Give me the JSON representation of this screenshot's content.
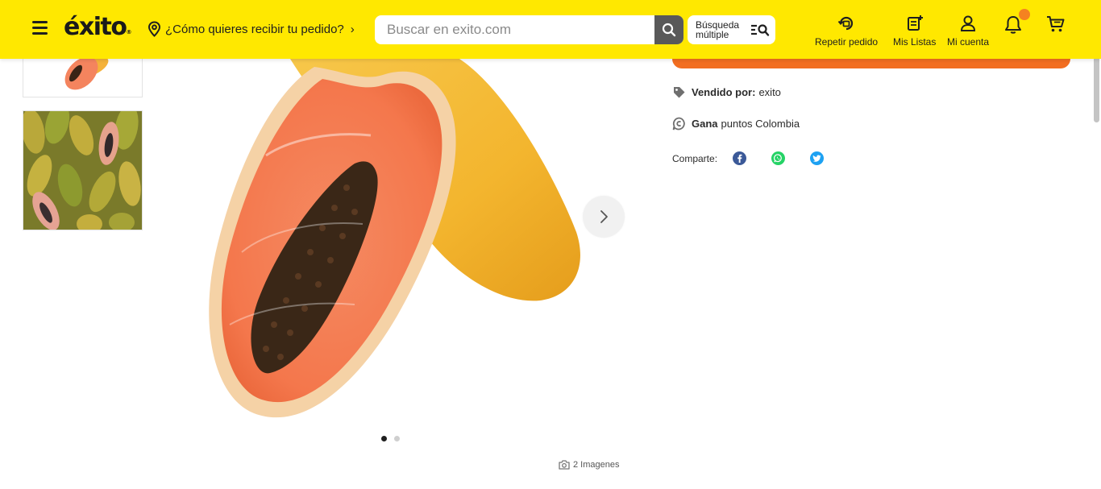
{
  "header": {
    "logo_text": "éxito",
    "logo_mark": "®",
    "delivery_prompt": "¿Cómo quieres recibir tu pedido?",
    "search_placeholder": "Buscar en exito.com",
    "multi_search_label": "Búsqueda múltiple",
    "nav": [
      {
        "label": "Repetir pedido",
        "icon": "repeat-order-icon"
      },
      {
        "label": "Mis Listas",
        "icon": "lists-icon"
      },
      {
        "label": "Mi cuenta",
        "icon": "user-icon"
      }
    ],
    "notification_badge_color": "#f58220",
    "brand_color": "#ffe800"
  },
  "gallery": {
    "image_count_text": "2 Imagenes",
    "total_images": 2,
    "active_index": 0,
    "main_image_subject": "papaya"
  },
  "product_info": {
    "sold_by_label": "Vendido por:",
    "sold_by_value": "exito",
    "earn_label": "Gana",
    "earn_value": "puntos Colombia",
    "share_label": "Comparte:",
    "share_networks": [
      "facebook-icon",
      "whatsapp-icon",
      "twitter-icon"
    ],
    "accent_color": "#f26e21"
  }
}
